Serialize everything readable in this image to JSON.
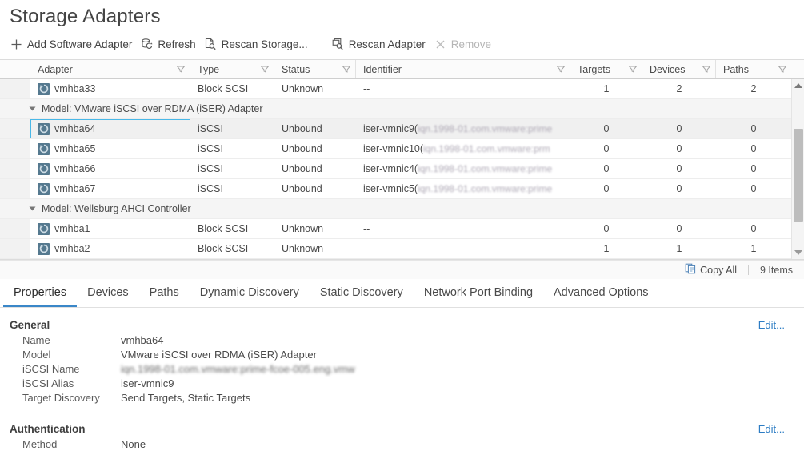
{
  "page": {
    "title": "Storage Adapters"
  },
  "toolbar": {
    "items": [
      {
        "label": "Add Software Adapter",
        "icon": "plus-icon",
        "disabled": false
      },
      {
        "label": "Refresh",
        "icon": "refresh-icon",
        "disabled": false
      },
      {
        "label": "Rescan Storage...",
        "icon": "rescan-storage-icon",
        "disabled": false
      },
      {
        "label": "Rescan Adapter",
        "icon": "rescan-adapter-icon",
        "disabled": false
      },
      {
        "label": "Remove",
        "icon": "close-x-icon",
        "disabled": true
      }
    ]
  },
  "grid": {
    "columns": [
      {
        "label": "Adapter",
        "filter": true
      },
      {
        "label": "Type",
        "filter": true
      },
      {
        "label": "Status",
        "filter": true
      },
      {
        "label": "Identifier",
        "filter": true
      },
      {
        "label": "Targets",
        "filter": true
      },
      {
        "label": "Devices",
        "filter": true
      },
      {
        "label": "Paths",
        "filter": true
      }
    ],
    "rows": [
      {
        "kind": "data",
        "adapter": "vmhba33",
        "type": "Block SCSI",
        "status": "Unknown",
        "identifier": "--",
        "identifier_blur": "",
        "targets": "1",
        "devices": "2",
        "paths": "2",
        "selected": false
      },
      {
        "kind": "group",
        "label": "Model: VMware iSCSI over RDMA (iSER) Adapter"
      },
      {
        "kind": "data",
        "adapter": "vmhba64",
        "type": "iSCSI",
        "status": "Unbound",
        "identifier": "iser-vmnic9(",
        "identifier_blur": "iqn.1998-01.com.vmware:prime",
        "targets": "0",
        "devices": "0",
        "paths": "0",
        "selected": true
      },
      {
        "kind": "data",
        "adapter": "vmhba65",
        "type": "iSCSI",
        "status": "Unbound",
        "identifier": "iser-vmnic10(",
        "identifier_blur": "iqn.1998-01.com.vmware:prm",
        "targets": "0",
        "devices": "0",
        "paths": "0",
        "selected": false
      },
      {
        "kind": "data",
        "adapter": "vmhba66",
        "type": "iSCSI",
        "status": "Unbound",
        "identifier": "iser-vmnic4(",
        "identifier_blur": "iqn.1998-01.com.vmware:prime",
        "targets": "0",
        "devices": "0",
        "paths": "0",
        "selected": false
      },
      {
        "kind": "data",
        "adapter": "vmhba67",
        "type": "iSCSI",
        "status": "Unbound",
        "identifier": "iser-vmnic5(",
        "identifier_blur": "iqn.1998-01.com.vmware:prime",
        "targets": "0",
        "devices": "0",
        "paths": "0",
        "selected": false
      },
      {
        "kind": "group",
        "label": "Model: Wellsburg AHCI Controller"
      },
      {
        "kind": "data",
        "adapter": "vmhba1",
        "type": "Block SCSI",
        "status": "Unknown",
        "identifier": "--",
        "identifier_blur": "",
        "targets": "0",
        "devices": "0",
        "paths": "0",
        "selected": false
      },
      {
        "kind": "data",
        "adapter": "vmhba2",
        "type": "Block SCSI",
        "status": "Unknown",
        "identifier": "--",
        "identifier_blur": "",
        "targets": "1",
        "devices": "1",
        "paths": "1",
        "selected": false
      }
    ],
    "footer": {
      "copy_all_label": "Copy All",
      "item_count_label": "9 Items"
    }
  },
  "tabs": [
    {
      "label": "Properties",
      "active": true
    },
    {
      "label": "Devices",
      "active": false
    },
    {
      "label": "Paths",
      "active": false
    },
    {
      "label": "Dynamic Discovery",
      "active": false
    },
    {
      "label": "Static Discovery",
      "active": false
    },
    {
      "label": "Network Port Binding",
      "active": false
    },
    {
      "label": "Advanced Options",
      "active": false
    }
  ],
  "details": {
    "general": {
      "title": "General",
      "edit_label": "Edit...",
      "fields": [
        {
          "key": "Name",
          "value": "vmhba64",
          "blurred": false
        },
        {
          "key": "Model",
          "value": "VMware iSCSI over RDMA (iSER) Adapter",
          "blurred": false
        },
        {
          "key": "iSCSI Name",
          "value": "iqn.1998-01.com.vmware:prime-fcoe-005.eng.vmw",
          "blurred": true
        },
        {
          "key": "iSCSI Alias",
          "value": "iser-vmnic9",
          "blurred": false
        },
        {
          "key": "Target Discovery",
          "value": "Send Targets, Static Targets",
          "blurred": false
        }
      ]
    },
    "authentication": {
      "title": "Authentication",
      "edit_label": "Edit...",
      "fields": [
        {
          "key": "Method",
          "value": "None",
          "blurred": false
        }
      ]
    }
  },
  "colors": {
    "accent": "#3a87c8",
    "link": "#2d7dc4",
    "focus": "#49b8e8",
    "adapter_icon": "#55798f"
  }
}
